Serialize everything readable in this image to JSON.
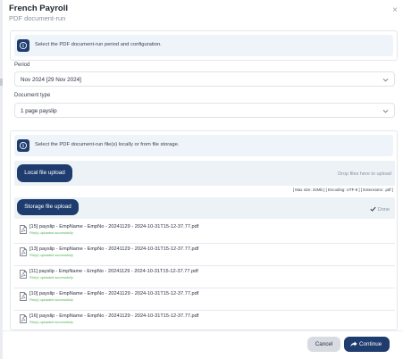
{
  "dialog": {
    "title": "French Payroll",
    "subtitle": "PDF document-run",
    "close_glyph": "×"
  },
  "config_info": {
    "icon": "info-icon",
    "text": "Select the PDF document-run period and configuration."
  },
  "period": {
    "label": "Period",
    "value": "Nov 2024 [29 Nov 2024]"
  },
  "document_type": {
    "label": "Document type",
    "value": "1 page payslip"
  },
  "files_info": {
    "icon": "info-icon",
    "text": "Select the PDF document-run file(s) locally or from file storage."
  },
  "local_upload": {
    "button_label": "Local file upload",
    "drop_text": "Drop files here to upload",
    "constraints": "[ Max size: 32Mb ] [ Encoding: UTF-8 ] [ Extensions: .pdf ]"
  },
  "storage_upload": {
    "button_label": "Storage file upload",
    "done_label": "Done"
  },
  "files": [
    {
      "name": "[15] payslip - EmpName - EmpNo - 20241129 - 2024-10-31T15-12-37.77.pdf",
      "status": "File(s) uploaded successfully"
    },
    {
      "name": "[13] payslip - EmpName - EmpNo - 20241129 - 2024-10-31T15-12-37.77.pdf",
      "status": "File(s) uploaded successfully"
    },
    {
      "name": "[11] payslip - EmpName - EmpNo - 20241129 - 2024-10-31T15-12-37.77.pdf",
      "status": "File(s) uploaded successfully"
    },
    {
      "name": "[10] payslip - EmpName - EmpNo - 20241129 - 2024-10-31T15-12-37.77.pdf",
      "status": "File(s) uploaded successfully"
    },
    {
      "name": "[16] payslip - EmpName - EmpNo - 20241129 - 2024-10-31T15-12-37.77.pdf",
      "status": "File(s) uploaded successfully"
    }
  ],
  "footer": {
    "cancel_label": "Cancel",
    "continue_label": "Continue"
  },
  "colors": {
    "primary": "#1f3c6e",
    "info_background": "#eef4fa",
    "upload_zone": "#edf2f7",
    "success": "#4caf50",
    "cancel_background": "#d9dbe2"
  }
}
